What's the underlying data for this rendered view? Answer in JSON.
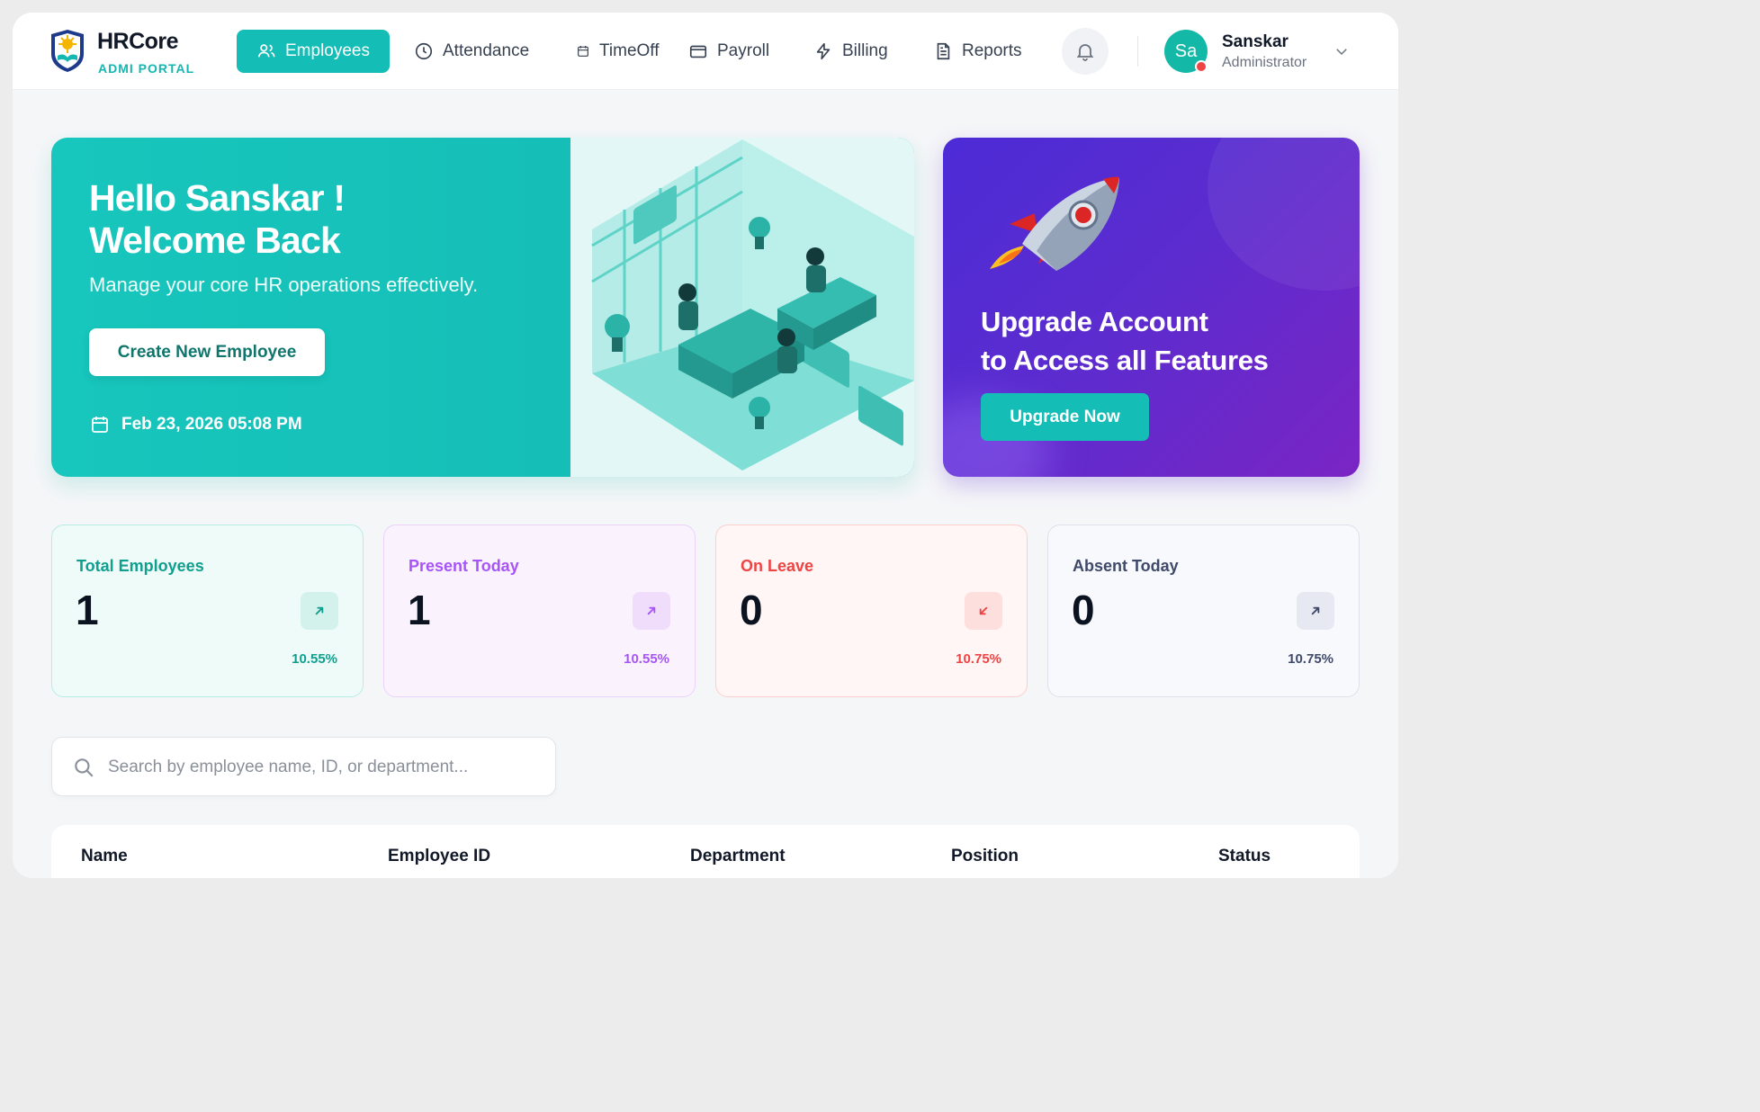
{
  "brand": {
    "name": "HRCore",
    "subtitle": "ADMI PORTAL"
  },
  "nav": [
    {
      "label": "Employees",
      "icon": "users-icon",
      "active": true
    },
    {
      "label": "Attendance",
      "icon": "clock-icon"
    },
    {
      "label": "TimeOff",
      "icon": "calendar-icon"
    },
    {
      "label": "Payroll",
      "icon": "card-icon"
    },
    {
      "label": "Billing",
      "icon": "bolt-icon"
    },
    {
      "label": "Reports",
      "icon": "document-icon"
    }
  ],
  "user": {
    "initials": "Sa",
    "name": "Sanskar",
    "role": "Administrator"
  },
  "hero": {
    "title_line1": "Hello Sanskar !",
    "title_line2": "Welcome Back",
    "subtitle": "Manage your core HR operations effectively.",
    "button_label": "Create New Employee",
    "datetime": "Feb 23, 2026 05:08 PM"
  },
  "upgrade": {
    "title_line1": "Upgrade Account",
    "title_line2": "to Access all Features",
    "button_label": "Upgrade Now"
  },
  "stats": [
    {
      "label": "Total Employees",
      "value": "1",
      "percent": "10.55%",
      "trend": "up",
      "accent": "#0f9f8f",
      "bg": "#effbf8",
      "border": "#b6ece2",
      "icon_bg": "#d4f2ec"
    },
    {
      "label": "Present Today",
      "value": "1",
      "percent": "10.55%",
      "trend": "up",
      "accent": "#a855f7",
      "bg": "#faf3fe",
      "border": "#ead2fb",
      "icon_bg": "#f0ddfc"
    },
    {
      "label": "On Leave",
      "value": "0",
      "percent": "10.75%",
      "trend": "down",
      "accent": "#ef4444",
      "bg": "#fff6f5",
      "border": "#fbcfcb",
      "icon_bg": "#fde0de"
    },
    {
      "label": "Absent Today",
      "value": "0",
      "percent": "10.75%",
      "trend": "up",
      "accent": "#3f4a6b",
      "bg": "#f8f9fc",
      "border": "#dde1ec",
      "icon_bg": "#e6e9f2"
    }
  ],
  "search": {
    "placeholder": "Search by employee name, ID, or department..."
  },
  "table": {
    "columns": [
      "Name",
      "Employee ID",
      "Department",
      "Position",
      "Status"
    ]
  }
}
